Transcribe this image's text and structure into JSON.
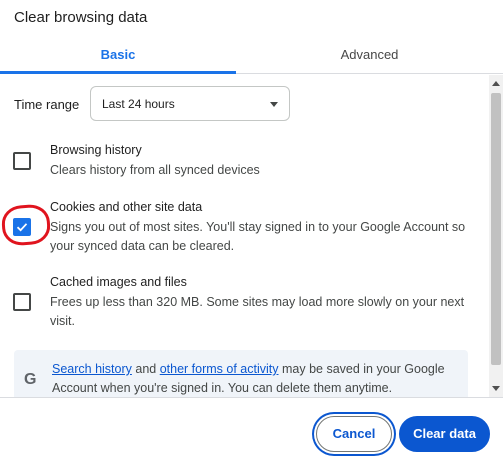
{
  "dialog": {
    "title": "Clear browsing data"
  },
  "tabs": [
    {
      "label": "Basic",
      "selected": true
    },
    {
      "label": "Advanced",
      "selected": false
    }
  ],
  "time_range": {
    "label": "Time range",
    "value": "Last 24 hours"
  },
  "options": [
    {
      "title": "Browsing history",
      "description": "Clears history from all synced devices",
      "checked": false
    },
    {
      "title": "Cookies and other site data",
      "description": "Signs you out of most sites. You'll stay signed in to your Google Account so your synced data can be cleared.",
      "checked": true
    },
    {
      "title": "Cached images and files",
      "description": "Frees up less than 320 MB. Some sites may load more slowly on your next visit.",
      "checked": false
    }
  ],
  "info_box": {
    "icon": "google-g-icon",
    "link1": "Search history",
    "text1": " and ",
    "link2": "other forms of activity",
    "text2": " may be saved in your Google Account when you're signed in. You can delete them anytime."
  },
  "buttons": {
    "cancel": "Cancel",
    "clear": "Clear data"
  },
  "colors": {
    "accent": "#1a73e8",
    "primary_button": "#0b57d0",
    "annotation": "#e0141e"
  }
}
